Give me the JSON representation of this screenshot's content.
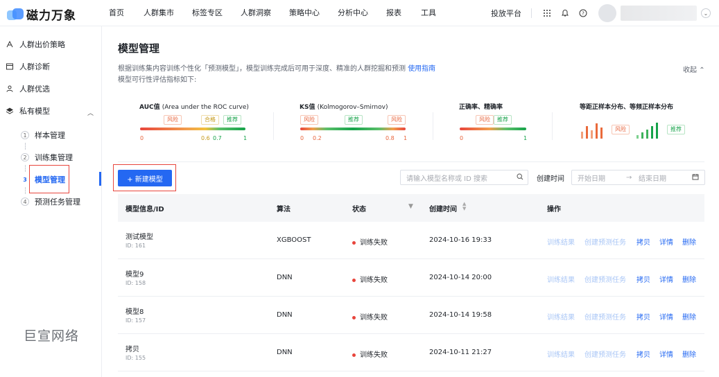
{
  "brand": {
    "name": "磁力万象"
  },
  "nav": [
    {
      "label": "首页"
    },
    {
      "label": "人群集市"
    },
    {
      "label": "标签专区"
    },
    {
      "label": "人群洞察"
    },
    {
      "label": "策略中心"
    },
    {
      "label": "分析中心"
    },
    {
      "label": "报表"
    },
    {
      "label": "工具"
    }
  ],
  "topright": {
    "platform": "投放平台",
    "icons": [
      "grid-icon",
      "bell-icon",
      "help-icon"
    ]
  },
  "sidebar": {
    "items": [
      {
        "label": "人群出价策略",
        "icon": "strategy-icon"
      },
      {
        "label": "人群诊断",
        "icon": "diagnosis-icon"
      },
      {
        "label": "人群优选",
        "icon": "users-icon"
      },
      {
        "label": "私有模型",
        "icon": "layers-icon"
      }
    ],
    "subitems": [
      {
        "num": "1",
        "label": "样本管理"
      },
      {
        "num": "2",
        "label": "训练集管理"
      },
      {
        "num": "3",
        "label": "模型管理"
      },
      {
        "num": "4",
        "label": "预测任务管理"
      }
    ]
  },
  "watermark": "巨宣网络",
  "page": {
    "title": "模型管理",
    "desc_line1": "根据训练集内容训练个性化「预测模型」，模型训练完成后可用于深度、精准的人群挖掘和预测",
    "guide_link": "使用指南",
    "desc_line2": "模型可行性评估指标如下:",
    "collapse": "收起"
  },
  "metrics": {
    "auc": {
      "title": "AUC值",
      "subtitle": "(Area under the ROC curve)",
      "tags": [
        "风险",
        "合格",
        "推荐"
      ],
      "ticks": [
        "0",
        "0.6",
        "0.7",
        "1"
      ]
    },
    "ks": {
      "title": "KS值",
      "subtitle": "(Kolmogorov–Smirnov)",
      "tags": [
        "风险",
        "推荐",
        "风险"
      ],
      "ticks": [
        "0",
        "0.2",
        "0.8",
        "1"
      ]
    },
    "acc": {
      "title": "正确率、精确率",
      "tags": [
        "风险",
        "推荐"
      ],
      "ticks": [
        "0",
        "1"
      ]
    },
    "dist": {
      "title": "等距正样本分布、等频正样本分布",
      "tags": [
        "风险",
        "推荐"
      ]
    }
  },
  "toolbar": {
    "new_button": "+ 新建模型",
    "search_placeholder": "请输入模型名称或 ID 搜索",
    "created_label": "创建时间",
    "start_placeholder": "开始日期",
    "end_placeholder": "结束日期",
    "arrow": "→"
  },
  "table": {
    "headers": {
      "info": "模型信息/ID",
      "algo": "算法",
      "status": "状态",
      "created": "创建时间",
      "ops": "操作"
    },
    "id_prefix": "ID:",
    "rows": [
      {
        "name": "测试模型",
        "id": "161",
        "algo": "XGBOOST",
        "status": "训练失败",
        "created": "2024-10-16 19:33"
      },
      {
        "name": "模型9",
        "id": "158",
        "algo": "DNN",
        "status": "训练失败",
        "created": "2024-10-14 20:00"
      },
      {
        "name": "模型8",
        "id": "157",
        "algo": "DNN",
        "status": "训练失败",
        "created": "2024-10-14 19:58"
      },
      {
        "name": "拷贝",
        "id": "155",
        "algo": "DNN",
        "status": "训练失败",
        "created": "2024-10-11 21:27"
      }
    ],
    "ops": [
      "训练结果",
      "创建预测任务",
      "拷贝",
      "详情",
      "删除"
    ]
  }
}
